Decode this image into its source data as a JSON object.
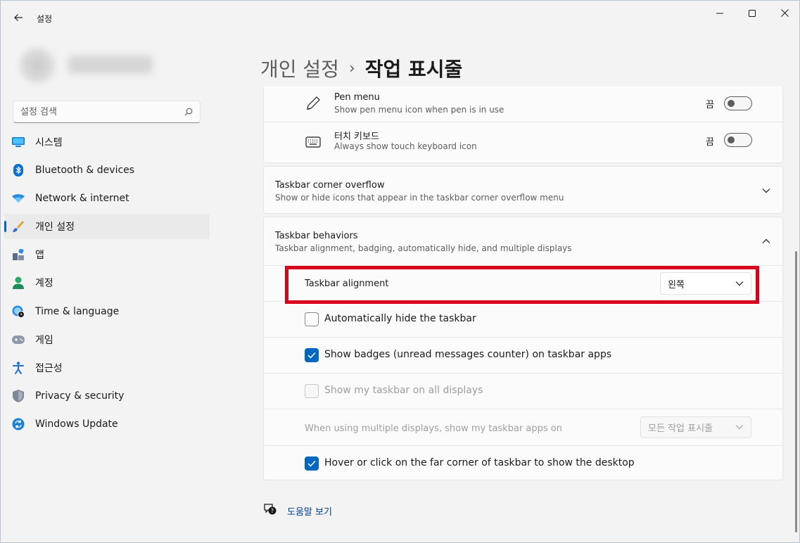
{
  "window": {
    "title": "설정",
    "back_icon": "back-arrow-icon",
    "minimize_icon": "minimize-icon",
    "maximize_icon": "maximize-icon",
    "close_icon": "close-icon"
  },
  "search": {
    "placeholder": "설정 검색",
    "icon": "search-icon"
  },
  "sidebar": {
    "items": [
      {
        "label": "시스템",
        "icon": "system-icon",
        "active": false
      },
      {
        "label": "Bluetooth & devices",
        "icon": "bluetooth-icon",
        "active": false
      },
      {
        "label": "Network & internet",
        "icon": "wifi-icon",
        "active": false
      },
      {
        "label": "개인 설정",
        "icon": "brush-icon",
        "active": true
      },
      {
        "label": "앱",
        "icon": "apps-icon",
        "active": false
      },
      {
        "label": "계정",
        "icon": "account-icon",
        "active": false
      },
      {
        "label": "Time & language",
        "icon": "globe-clock-icon",
        "active": false
      },
      {
        "label": "게임",
        "icon": "gamepad-icon",
        "active": false
      },
      {
        "label": "접근성",
        "icon": "accessibility-icon",
        "active": false
      },
      {
        "label": "Privacy & security",
        "icon": "shield-icon",
        "active": false
      },
      {
        "label": "Windows Update",
        "icon": "update-icon",
        "active": false
      }
    ]
  },
  "breadcrumb": {
    "parent": "개인 설정",
    "separator": "›",
    "current": "작업 표시줄"
  },
  "taskbar_icons_card": {
    "rows": [
      {
        "title": "Pen menu",
        "description": "Show pen menu icon when pen is in use",
        "icon": "pen-icon",
        "toggle_label": "끔",
        "toggle_on": false
      },
      {
        "title": "터치 키보드",
        "description": "Always show touch keyboard icon",
        "icon": "keyboard-icon",
        "toggle_label": "끔",
        "toggle_on": false
      }
    ]
  },
  "corner_overflow": {
    "title": "Taskbar corner overflow",
    "description": "Show or hide icons that appear in the taskbar corner overflow menu",
    "expanded": false
  },
  "behaviors": {
    "title": "Taskbar behaviors",
    "description": "Taskbar alignment, badging, automatically hide, and multiple displays",
    "expanded": true,
    "alignment_label": "Taskbar alignment",
    "alignment_value": "왼쪽",
    "auto_hide_label": "Automatically hide the taskbar",
    "auto_hide_checked": false,
    "badges_label": "Show badges (unread messages counter) on taskbar apps",
    "badges_checked": true,
    "all_displays_label": "Show my taskbar on all displays",
    "all_displays_checked": false,
    "all_displays_disabled": true,
    "multi_display_label": "When using multiple displays, show my taskbar apps on",
    "multi_display_value": "모든 작업 표시줄",
    "multi_display_disabled": true,
    "far_corner_label": "Hover or click on the far corner of taskbar to show the desktop",
    "far_corner_checked": true
  },
  "help": {
    "label": "도움말 보기",
    "icon": "help-icon"
  },
  "colors": {
    "accent": "#0067c0",
    "highlight_box": "#d9001b",
    "window_bg": "#f3f3f3",
    "card_bg": "#fbfbfb"
  }
}
